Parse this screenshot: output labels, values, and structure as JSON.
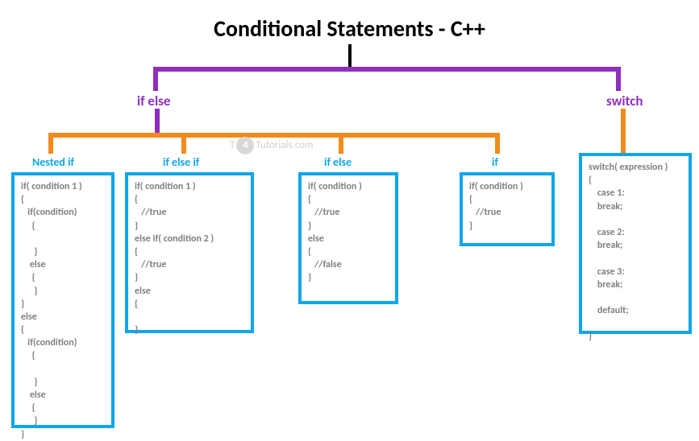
{
  "title": "Conditional Statements - C++",
  "branches": {
    "ifelse": "if else",
    "switch": "switch"
  },
  "children": {
    "nested_if": "Nested if",
    "if_else_if": "if else if",
    "if_else": "if else",
    "if": "if"
  },
  "code": {
    "nested_if": "if( condition 1 )\n{\n   if(condition)\n     {\n\n      }\n    else\n     {\n      }\n}\nelse\n{\n   if(condition)\n     {\n\n      }\n    else\n     {\n      }\n}",
    "if_else_if": "if( condition 1 )\n{\n   //true\n}\nelse if( condition 2 )\n{\n   //true\n}\nelse\n{\n\n}",
    "if_else": "if( condition )\n{\n   //true\n}\nelse\n{\n   //false\n}",
    "if": "if( condition )\n{\n   //true\n}",
    "switch": "switch( expression )\n{\n    case 1:\n    break;\n\n    case 2:\n    break;\n\n    case 3:\n    break;\n\n    default;\n\n}"
  },
  "watermark": {
    "prefix": "T",
    "num": "4",
    "suffix": "Tutorials.com"
  }
}
